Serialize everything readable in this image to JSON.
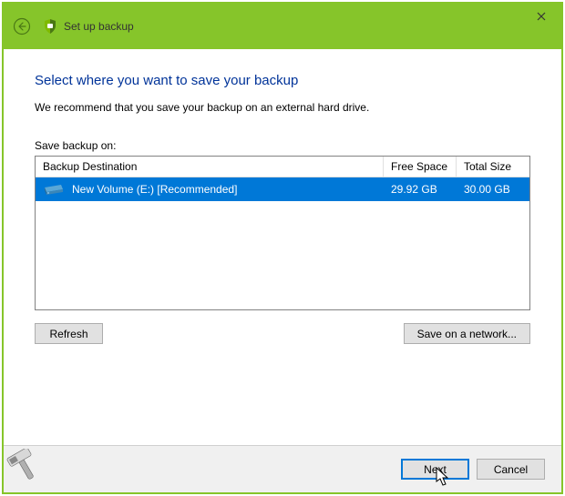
{
  "window": {
    "title": "Set up backup"
  },
  "main": {
    "heading": "Select where you want to save your backup",
    "description": "We recommend that you save your backup on an external hard drive.",
    "save_on_label": "Save backup on:"
  },
  "drives": {
    "columns": {
      "destination": "Backup Destination",
      "free": "Free Space",
      "total": "Total Size"
    },
    "rows": [
      {
        "name": "New Volume (E:) [Recommended]",
        "free": "29.92 GB",
        "total": "30.00 GB",
        "selected": true
      }
    ]
  },
  "buttons": {
    "refresh": "Refresh",
    "network": "Save on a network...",
    "next": "Next",
    "cancel": "Cancel"
  }
}
